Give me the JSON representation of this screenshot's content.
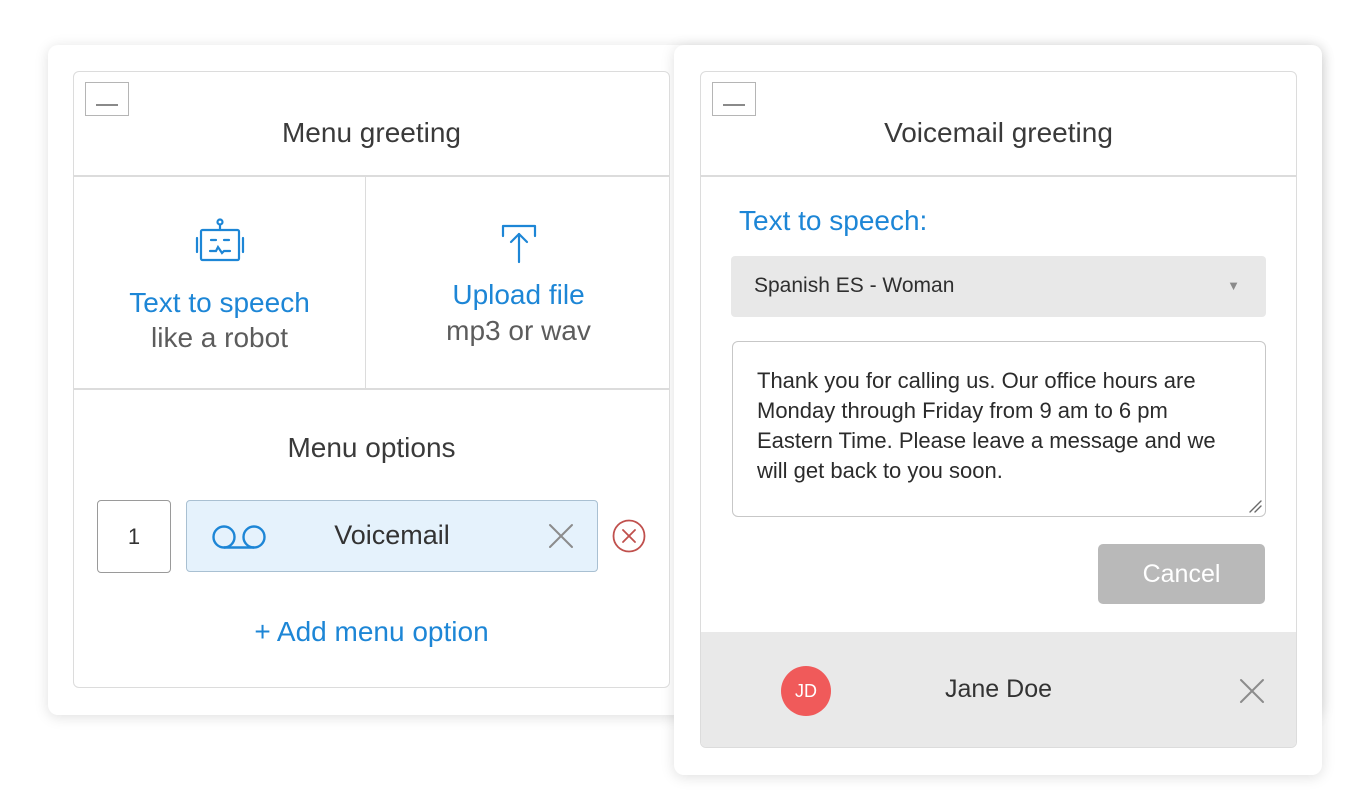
{
  "menu_panel": {
    "title": "Menu greeting",
    "tts_option": {
      "label": "Text to speech",
      "sublabel": "like a robot",
      "icon": "robot-icon"
    },
    "upload_option": {
      "label": "Upload file",
      "sublabel": "mp3 or wav",
      "icon": "upload-icon"
    },
    "menu_options_title": "Menu options",
    "menu_options": [
      {
        "key": "1",
        "label": "Voicemail",
        "icon": "voicemail-icon"
      }
    ],
    "add_option_label": "+ Add menu option"
  },
  "voicemail_panel": {
    "title": "Voicemail greeting",
    "tts_heading": "Text to speech:",
    "voice_select": {
      "value": "Spanish ES - Woman",
      "caret": "▼"
    },
    "greeting_text": "Thank you for calling us. Our office hours are Monday through Friday from 9 am to 6 pm Eastern Time. Please leave a message and we will get back to you soon.",
    "cancel_label": "Cancel",
    "user": {
      "initials": "JD",
      "name": "Jane Doe"
    }
  },
  "colors": {
    "accent": "#1d86d6",
    "avatar": "#f05a5a",
    "remove": "#c0504d",
    "pill_bg": "#e5f2fc"
  }
}
